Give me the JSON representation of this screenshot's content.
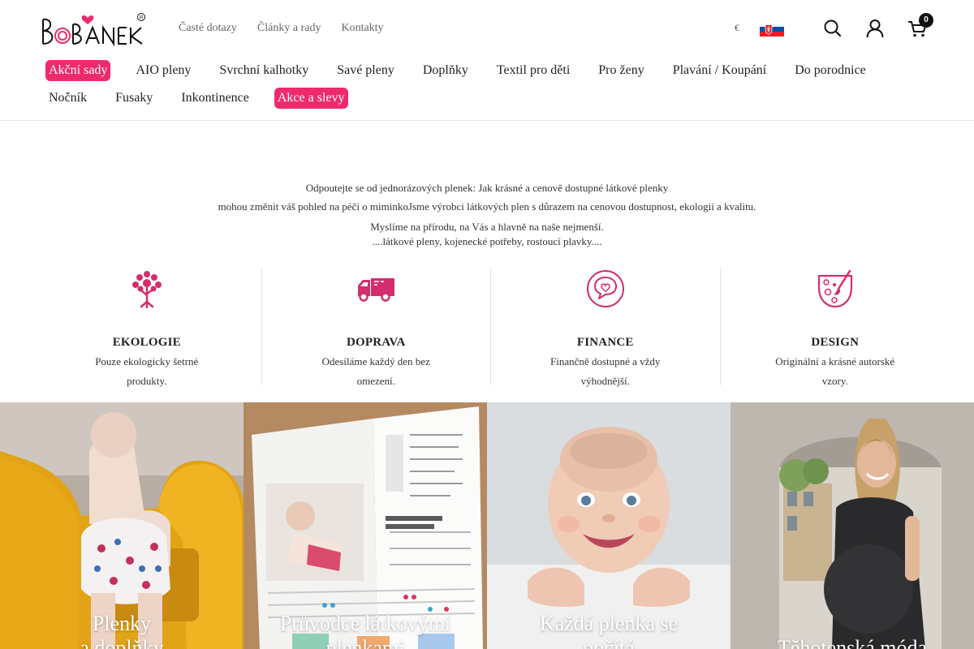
{
  "header": {
    "logo_text": "BOBANEK",
    "top_links": [
      "Časté dotazy",
      "Články a rady",
      "Kontakty"
    ],
    "currency": "€",
    "cart_count": "0"
  },
  "nav": {
    "row1": [
      "Akční sady",
      "AIO pleny",
      "Svrchní kalhotky",
      "Savé pleny",
      "Doplňky",
      "Textil pro děti",
      "Pro ženy",
      "Plavání / Koupání",
      "Do porodnice"
    ],
    "row2": [
      "Nočník",
      "Fusaky",
      "Inkontinence",
      "Akce a slevy"
    ]
  },
  "intro": {
    "line1": "Odpoutejte se od jednorázových plenek: Jak krásné a cenově dostupné látkové plenky",
    "line2": "mohou změnit váš pohled na péči o miminkoJsme výrobci látkových plen s důrazem na cenovou dostupnost, ekologii a kvalitu.",
    "line3": "Myslíme na přírodu, na Vás a hlavně na naše nejmenší.",
    "line4": "....látkové pleny, kojenecké potřeby, rostoucí plavky...."
  },
  "features": [
    {
      "title": "EKOLOGIE",
      "text": "Pouze ekologicky šetrné produkty.",
      "icon": "tree-icon"
    },
    {
      "title": "DOPRAVA",
      "text": "Odesíláme každý den bez omezení.",
      "icon": "truck-icon"
    },
    {
      "title": "FINANCE",
      "text": "Finančně dostupné a vždy výhodnější.",
      "icon": "chat-bubble-icon"
    },
    {
      "title": "DESIGN",
      "text": "Originální a krásné autorské vzory.",
      "icon": "diaper-brush-icon"
    }
  ],
  "tiles": [
    {
      "line1": "Plenky",
      "line2": "a doplňky"
    },
    {
      "line1": "Průvodce látkovými",
      "line2": "plenkami"
    },
    {
      "line1": "Každá plenka se",
      "line2": "počítá"
    },
    {
      "line1": "",
      "line2": "Těhotenská móda"
    }
  ],
  "colors": {
    "accent": "#ee2a6e"
  }
}
